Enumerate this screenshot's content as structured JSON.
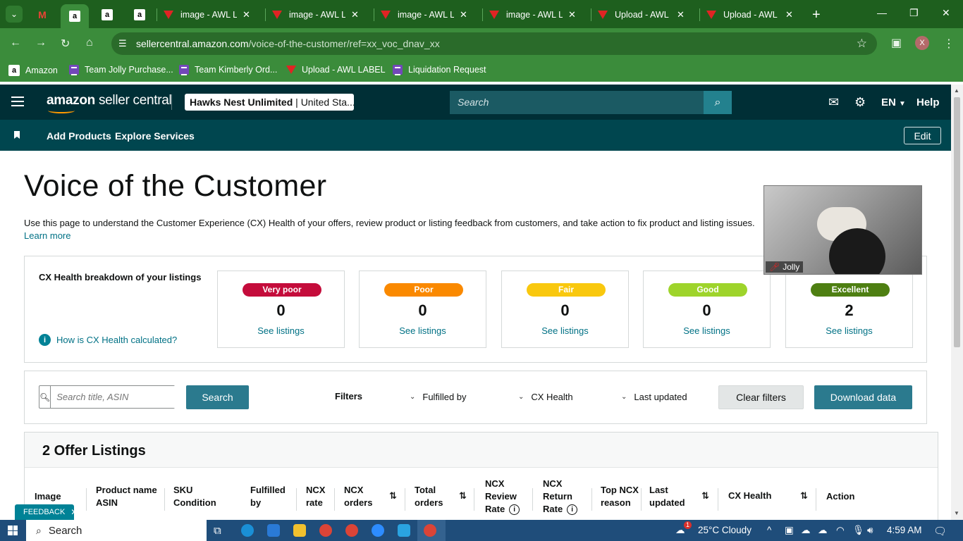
{
  "browser": {
    "tabs": [
      {
        "title": "image - AWL LA"
      },
      {
        "title": "image - AWL LA"
      },
      {
        "title": "image - AWL LA"
      },
      {
        "title": "image - AWL LA"
      },
      {
        "title": "Upload - AWL L"
      },
      {
        "title": "Upload - AWL L"
      }
    ],
    "url_host": "sellercentral.amazon.com",
    "url_path": "/voice-of-the-customer/ref=xx_voc_dnav_xx",
    "profile_initial": "X",
    "bookmarks": [
      {
        "label": "Amazon"
      },
      {
        "label": "Team Jolly Purchase..."
      },
      {
        "label": "Team Kimberly Ord..."
      },
      {
        "label": "Upload - AWL LABEL"
      },
      {
        "label": "Liquidation Request"
      }
    ]
  },
  "header": {
    "logo_brand": "amazon",
    "logo_text": "seller central",
    "store_name": "Hawks Nest Unlimited",
    "store_region": "United Sta...",
    "search_placeholder": "Search",
    "language": "EN",
    "help": "Help"
  },
  "subnav": {
    "links": [
      "Add Products",
      "Explore Services"
    ],
    "edit": "Edit"
  },
  "page": {
    "title": "Voice of the Customer",
    "description": "Use this page to understand the Customer Experience (CX) Health of your offers, review product or listing feedback from customers, and take action to fix product and listing issues.",
    "learn_more": "Learn more"
  },
  "health": {
    "title": "CX Health breakdown of your listings",
    "how_link": "How is CX Health calculated?",
    "cards": [
      {
        "label": "Very poor",
        "count": "0",
        "link": "See listings",
        "color": "#c40c3b"
      },
      {
        "label": "Poor",
        "count": "0",
        "link": "See listings",
        "color": "#fa8900"
      },
      {
        "label": "Fair",
        "count": "0",
        "link": "See listings",
        "color": "#f9c80e"
      },
      {
        "label": "Good",
        "count": "0",
        "link": "See listings",
        "color": "#9ed42b"
      },
      {
        "label": "Excellent",
        "count": "2",
        "link": "See listings",
        "color": "#4e7f12"
      }
    ]
  },
  "filters": {
    "search_placeholder": "Search title, ASIN",
    "search_button": "Search",
    "label": "Filters",
    "fulfilled_by": "Fulfilled by",
    "cx_health": "CX Health",
    "last_updated": "Last updated",
    "clear": "Clear filters",
    "download": "Download data"
  },
  "listings": {
    "title": "2 Offer Listings",
    "columns": {
      "image": "Image",
      "product_1": "Product name",
      "product_2": "ASIN",
      "sku_1": "SKU",
      "sku_2": "Condition",
      "fulfilled_1": "Fulfilled",
      "fulfilled_2": "by",
      "ncx_rate_1": "NCX",
      "ncx_rate_2": "rate",
      "ncx_orders_1": "NCX",
      "ncx_orders_2": "orders",
      "total_1": "Total",
      "total_2": "orders",
      "review_1": "NCX",
      "review_2": "Review",
      "review_3": "Rate",
      "return_1": "NCX",
      "return_2": "Return",
      "return_3": "Rate",
      "top_1": "Top NCX",
      "top_2": "reason",
      "last_1": "Last",
      "last_2": "updated",
      "cx_health": "CX Health",
      "action": "Action"
    }
  },
  "feedback": "FEEDBACK",
  "video": {
    "participant": "Jolly"
  },
  "taskbar": {
    "search": "Search",
    "weather": "25°C  Cloudy",
    "time": "4:59 AM",
    "notifications": "1"
  }
}
